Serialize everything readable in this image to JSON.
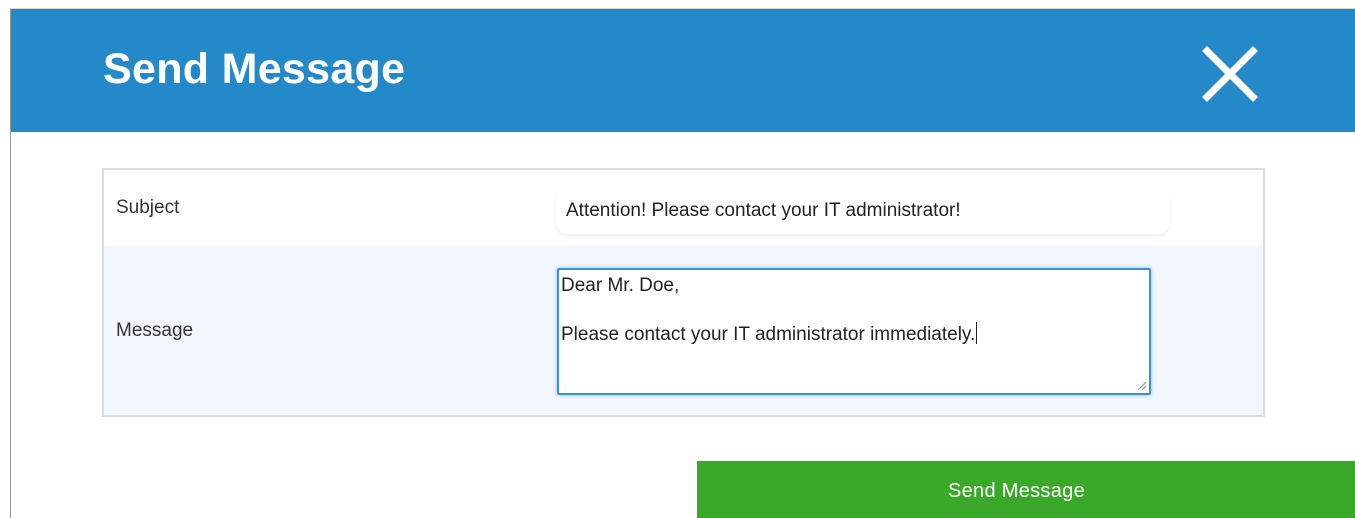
{
  "dialog": {
    "title": "Send Message",
    "close_icon": "close-icon"
  },
  "form": {
    "subject": {
      "label": "Subject",
      "value": "Attention! Please contact your IT administrator!"
    },
    "message": {
      "label": "Message",
      "value": "Dear Mr. Doe,\n\nPlease contact your IT administrator immediately."
    }
  },
  "actions": {
    "send_label": "Send Message"
  },
  "colors": {
    "header": "#2489c8",
    "send_button": "#3aa92a",
    "focus_border": "#3e8fd0",
    "message_row_bg": "#f1f7fc"
  }
}
